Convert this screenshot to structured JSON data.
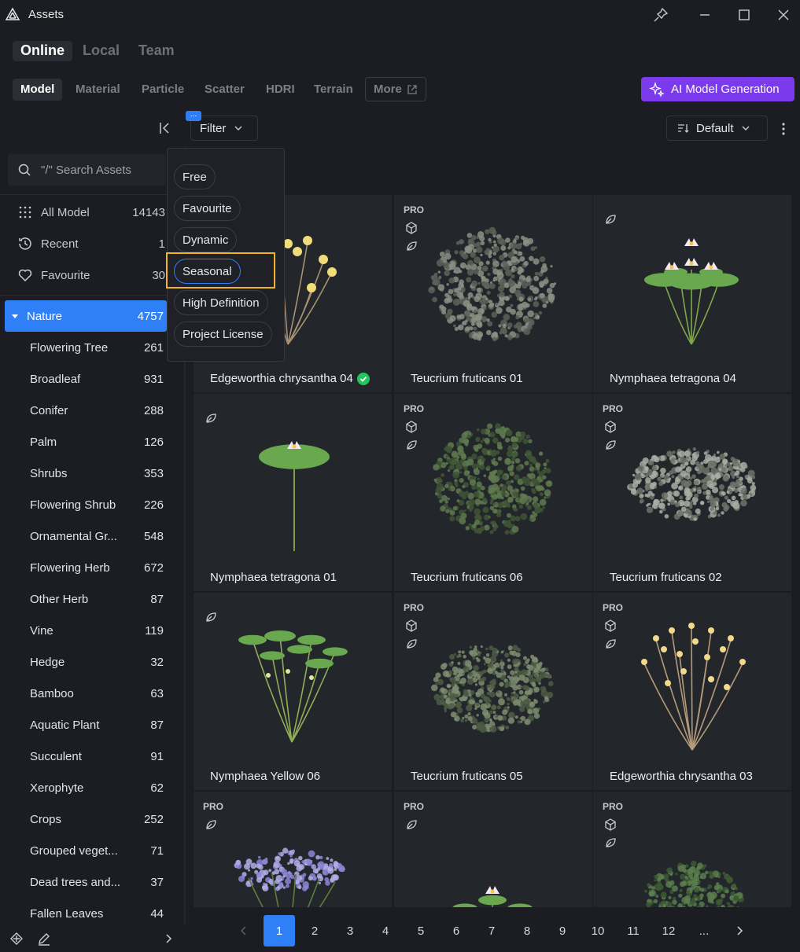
{
  "titlebar": {
    "title": "Assets"
  },
  "source_tabs": [
    {
      "label": "Online",
      "active": true
    },
    {
      "label": "Local",
      "active": false
    },
    {
      "label": "Team",
      "active": false
    }
  ],
  "category_tabs": [
    {
      "label": "Model",
      "active": true
    },
    {
      "label": "Material",
      "active": false
    },
    {
      "label": "Particle",
      "active": false
    },
    {
      "label": "Scatter",
      "active": false
    },
    {
      "label": "HDRI",
      "active": false
    },
    {
      "label": "Terrain",
      "active": false
    },
    {
      "label": "More",
      "active": false
    }
  ],
  "ai_button": {
    "label": "AI Model Generation"
  },
  "toolbar": {
    "filter_label": "Filter",
    "filter_badge": "...",
    "sort_label": "Default"
  },
  "search": {
    "placeholder": "\"/\" Search Assets"
  },
  "quick": [
    {
      "label": "All Model",
      "count": "14143",
      "icon": "grid-dots-icon"
    },
    {
      "label": "Recent",
      "count": "1",
      "icon": "history-icon"
    },
    {
      "label": "Favourite",
      "count": "30",
      "icon": "heart-icon"
    }
  ],
  "nature": {
    "label": "Nature",
    "count": "4757"
  },
  "subcategories": [
    {
      "label": "Flowering Tree",
      "count": "261"
    },
    {
      "label": "Broadleaf",
      "count": "931"
    },
    {
      "label": "Conifer",
      "count": "288"
    },
    {
      "label": "Palm",
      "count": "126"
    },
    {
      "label": "Shrubs",
      "count": "353"
    },
    {
      "label": "Flowering Shrub",
      "count": "226"
    },
    {
      "label": "Ornamental Gr...",
      "count": "548"
    },
    {
      "label": "Flowering Herb",
      "count": "672"
    },
    {
      "label": "Other Herb",
      "count": "87"
    },
    {
      "label": "Vine",
      "count": "119"
    },
    {
      "label": "Hedge",
      "count": "32"
    },
    {
      "label": "Bamboo",
      "count": "63"
    },
    {
      "label": "Aquatic Plant",
      "count": "87"
    },
    {
      "label": "Succulent",
      "count": "91"
    },
    {
      "label": "Xerophyte",
      "count": "62"
    },
    {
      "label": "Crops",
      "count": "252"
    },
    {
      "label": "Grouped veget...",
      "count": "71"
    },
    {
      "label": "Dead trees and...",
      "count": "37"
    },
    {
      "label": "Fallen Leaves",
      "count": "44"
    }
  ],
  "filter_options": [
    {
      "label": "Free",
      "selected": false
    },
    {
      "label": "Favourite",
      "selected": false
    },
    {
      "label": "Dynamic",
      "selected": false
    },
    {
      "label": "Seasonal",
      "selected": true
    },
    {
      "label": "High Definition",
      "selected": false
    },
    {
      "label": "Project License",
      "selected": false
    }
  ],
  "assets": [
    {
      "name": "Edgeworthia chrysantha 04",
      "pro": false,
      "cube": false,
      "leaf": false,
      "verified": true,
      "plant": "yellow-flower"
    },
    {
      "name": "Teucrium fruticans 01",
      "pro": true,
      "cube": true,
      "leaf": true,
      "verified": false,
      "plant": "grey-bush"
    },
    {
      "name": "Nymphaea tetragona 04",
      "pro": false,
      "cube": false,
      "leaf": true,
      "verified": false,
      "plant": "lily-cluster"
    },
    {
      "name": "Nymphaea tetragona 01",
      "pro": false,
      "cube": false,
      "leaf": true,
      "verified": false,
      "plant": "lily-single"
    },
    {
      "name": "Teucrium fruticans 06",
      "pro": true,
      "cube": true,
      "leaf": true,
      "verified": false,
      "plant": "green-bush"
    },
    {
      "name": "Teucrium fruticans 02",
      "pro": true,
      "cube": true,
      "leaf": true,
      "verified": false,
      "plant": "grey-dome"
    },
    {
      "name": "Nymphaea Yellow 06",
      "pro": false,
      "cube": false,
      "leaf": true,
      "verified": false,
      "plant": "lily-pads"
    },
    {
      "name": "Teucrium fruticans 05",
      "pro": true,
      "cube": true,
      "leaf": true,
      "verified": false,
      "plant": "green-dome"
    },
    {
      "name": "Edgeworthia chrysantha 03",
      "pro": true,
      "cube": true,
      "leaf": true,
      "verified": false,
      "plant": "yellow-tree"
    },
    {
      "name": "",
      "pro": true,
      "cube": false,
      "leaf": true,
      "verified": false,
      "plant": "purple-flowers"
    },
    {
      "name": "",
      "pro": true,
      "cube": false,
      "leaf": true,
      "verified": false,
      "plant": "pad-spread"
    },
    {
      "name": "",
      "pro": true,
      "cube": true,
      "leaf": true,
      "verified": false,
      "plant": "fern"
    }
  ],
  "pro_label": "PRO",
  "pagination": {
    "pages": [
      "1",
      "2",
      "3",
      "4",
      "5",
      "6",
      "7",
      "8",
      "9",
      "10",
      "11",
      "12",
      "..."
    ],
    "current": "1"
  },
  "colors": {
    "accent": "#2f80f6",
    "ai_purple": "#7c3aed",
    "highlight": "#f0b429",
    "verified": "#22c55e"
  }
}
